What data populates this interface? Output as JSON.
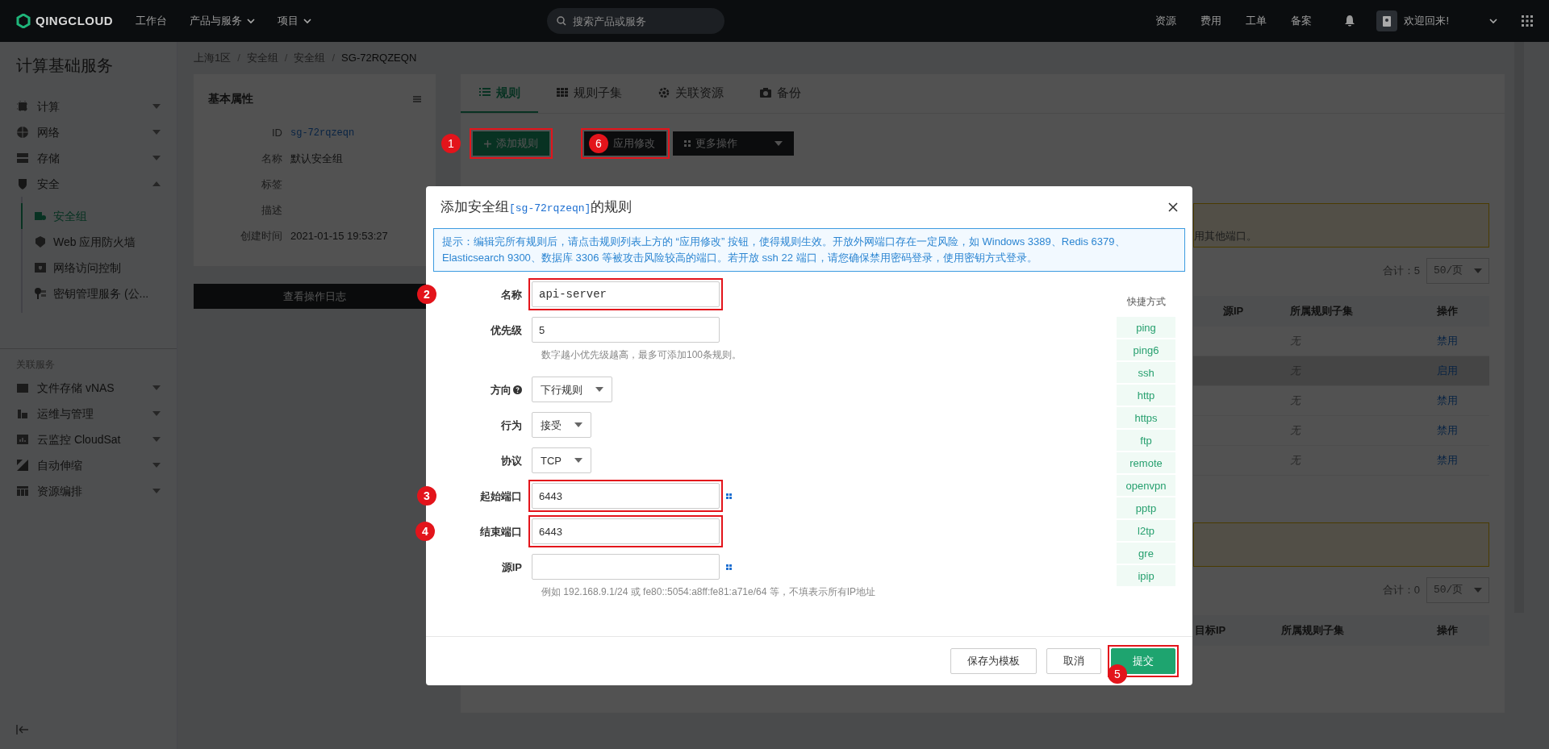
{
  "top_bar": {
    "logo": "QINGCLOUD",
    "menu": [
      {
        "label": "工作台",
        "dropdown": false
      },
      {
        "label": "产品与服务",
        "dropdown": true
      },
      {
        "label": "项目",
        "dropdown": true
      }
    ],
    "search": {
      "placeholder": "搜索产品或服务"
    },
    "links": [
      "资源",
      "费用",
      "工单",
      "备案"
    ],
    "greeting": "欢迎回来!"
  },
  "sidebar": {
    "title": "计算基础服务",
    "items": [
      {
        "label": "计算",
        "expanded": false
      },
      {
        "label": "网络",
        "expanded": false
      },
      {
        "label": "存储",
        "expanded": false
      },
      {
        "label": "安全",
        "expanded": true,
        "children": [
          {
            "label": "安全组",
            "selected": true
          },
          {
            "label": "Web 应用防火墙",
            "selected": false
          },
          {
            "label": "网络访问控制",
            "selected": false
          },
          {
            "label": "密钥管理服务 (公...",
            "selected": false
          }
        ]
      }
    ],
    "related_title": "关联服务",
    "related_items": [
      {
        "label": "文件存储 vNAS",
        "expanded": false
      },
      {
        "label": "运维与管理",
        "expanded": false
      },
      {
        "label": "云监控 CloudSat",
        "expanded": false
      },
      {
        "label": "自动伸缩",
        "expanded": false
      },
      {
        "label": "资源编排",
        "expanded": false
      }
    ]
  },
  "breadcrumb": [
    {
      "label": "上海1区",
      "kind": "link"
    },
    {
      "label": "/",
      "kind": "separator"
    },
    {
      "label": "安全组",
      "kind": "link"
    },
    {
      "label": "/",
      "kind": "separator"
    },
    {
      "label": "安全组",
      "kind": "link"
    },
    {
      "label": "/",
      "kind": "separator"
    },
    {
      "label": "SG-72RQZEQN",
      "kind": "current"
    }
  ],
  "properties": {
    "title": "基本属性",
    "rows": [
      {
        "label": "ID",
        "value": "sg-72rqzeqn",
        "kind": "code"
      },
      {
        "label": "名称",
        "value": "默认安全组",
        "kind": "text"
      },
      {
        "label": "标签"
      },
      {
        "label": "描述"
      },
      {
        "label": "创建时间",
        "value": "2021-01-15 19:53:27",
        "kind": "text"
      }
    ],
    "log_button": "查看操作日志"
  },
  "tabs": [
    {
      "label": "规则",
      "selected": true
    },
    {
      "label": "规则子集",
      "selected": false
    },
    {
      "label": "关联资源",
      "selected": false
    },
    {
      "label": "备份",
      "selected": false
    }
  ],
  "toolbar": [
    {
      "label": "添加规则",
      "kind": "primary",
      "marked": true,
      "marker": "1"
    },
    {
      "label": "应用修改",
      "kind": "dark",
      "marked": true,
      "marker": "6"
    },
    {
      "label": "更多操作",
      "kind": "menu",
      "marked": false
    }
  ],
  "downlink_rules": {
    "alert_fragment": "用其他端口。",
    "total": "合计：5",
    "page_size": "50/页",
    "columns": [
      "源IP",
      "所属规则子集",
      "操作"
    ],
    "rows": [
      {
        "subset": "无",
        "action": "禁用",
        "selected": false
      },
      {
        "subset": "无",
        "action": "启用",
        "selected": true
      },
      {
        "subset": "无",
        "action": "禁用",
        "selected": false
      },
      {
        "subset": "无",
        "action": "禁用",
        "selected": false
      },
      {
        "subset": "无",
        "action": "禁用",
        "selected": false
      }
    ]
  },
  "uplink_rules": {
    "total": "合计：0",
    "page_size": "50/页",
    "columns": [
      "目标IP",
      "所属规则子集",
      "操作"
    ]
  },
  "modal": {
    "title_prefix": "添加安全组",
    "title_code": "[sg-72rqzeqn]",
    "title_suffix": "的规则",
    "tip": "提示：编辑完所有规则后，请点击规则列表上方的 “应用修改” 按钮，使得规则生效。开放外网端口存在一定风险，如 Windows 3389、Redis 6379、Elasticsearch 9300、数据库 3306 等被攻击风险较高的端口。若开放 ssh 22 端口，请您确保禁用密码登录，使用密钥方式登录。",
    "fields": [
      {
        "label": "名称",
        "kind": "text",
        "value": "api-server",
        "mono": true,
        "marked": true,
        "marker": "2"
      },
      {
        "label": "优先级",
        "kind": "text",
        "value": "5",
        "hint": "数字越小优先级越高，最多可添加100条规则。",
        "marked": false
      },
      {
        "label": "方向",
        "kind": "select",
        "value": "下行规则",
        "help": true,
        "marked": false
      },
      {
        "label": "行为",
        "kind": "select",
        "value": "接受",
        "marked": false
      },
      {
        "label": "协议",
        "kind": "select",
        "value": "TCP",
        "marked": false
      },
      {
        "label": "起始端口",
        "kind": "text",
        "value": "6443",
        "picker": true,
        "marked": true,
        "marker": "3"
      },
      {
        "label": "结束端口",
        "kind": "text",
        "value": "6443",
        "marked": true,
        "marker": "4"
      },
      {
        "label": "源IP",
        "kind": "text",
        "picker": true,
        "hint": "例如 192.168.9.1/24 或 fe80::5054:a8ff:fe81:a71e/64 等，不填表示所有IP地址",
        "marked": false
      }
    ],
    "quick_title": "快捷方式",
    "quick": [
      "ping",
      "ping6",
      "ssh",
      "http",
      "https",
      "ftp",
      "remote",
      "openvpn",
      "pptp",
      "l2tp",
      "gre",
      "ipip"
    ],
    "buttons": [
      {
        "label": "保存为模板",
        "kind": "default",
        "marked": false
      },
      {
        "label": "取消",
        "kind": "default",
        "marked": false
      },
      {
        "label": "提交",
        "kind": "primary",
        "marked": true,
        "marker": "5"
      }
    ]
  }
}
